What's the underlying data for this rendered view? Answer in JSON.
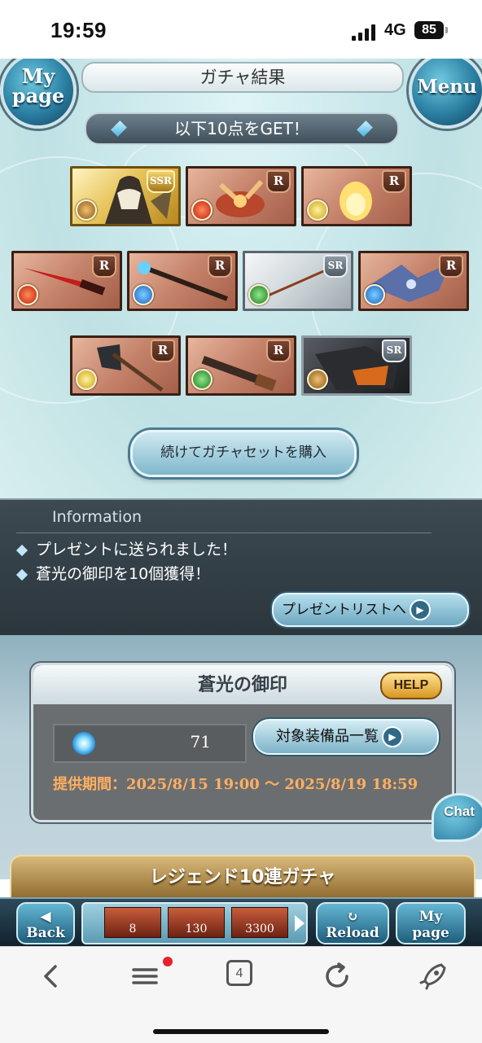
{
  "status_bar": {
    "time": "19:59",
    "network": "4G",
    "battery": "85"
  },
  "header": {
    "title": "ガチャ結果",
    "mypage_line1": "My",
    "mypage_line2": "page",
    "menu_label": "Menu"
  },
  "result": {
    "get_text": "以下10点をGET！",
    "items": [
      {
        "rarity": "SSR",
        "element": "earth"
      },
      {
        "rarity": "R",
        "element": "fire"
      },
      {
        "rarity": "R",
        "element": "light"
      },
      {
        "rarity": "R",
        "element": "fire"
      },
      {
        "rarity": "R",
        "element": "water"
      },
      {
        "rarity": "SR",
        "element": "wind"
      },
      {
        "rarity": "R",
        "element": "water"
      },
      {
        "rarity": "R",
        "element": "light"
      },
      {
        "rarity": "R",
        "element": "wind"
      },
      {
        "rarity": "SR",
        "element": "earth"
      }
    ],
    "buy_again_label": "続けてガチャセットを購入"
  },
  "information": {
    "title": "Information",
    "messages": [
      "プレゼントに送られました！",
      "蒼光の御印を10個獲得！"
    ],
    "present_list_label": "プレゼントリストへ"
  },
  "seal": {
    "title": "蒼光の御印",
    "help_label": "HELP",
    "count": "71",
    "equip_list_label": "対象装備品一覧",
    "period": "提供期間：2025/8/15 19:00 〜 2025/8/19 18:59"
  },
  "chat_label": "Chat",
  "legend_banner": "レジェンド10連ガチャ",
  "game_nav": {
    "back_line1": "◀",
    "back_line2": "Back",
    "items": [
      "8",
      "130",
      "3300"
    ],
    "reload_line1": "↻",
    "reload_line2": "Reload",
    "mypage_line1": "My",
    "mypage_line2": "page"
  },
  "browser": {
    "tab_count": "4"
  },
  "colors": {
    "accent": "#2b7fa3",
    "period_text": "#ffb061",
    "info_bg": "#2b353c"
  }
}
